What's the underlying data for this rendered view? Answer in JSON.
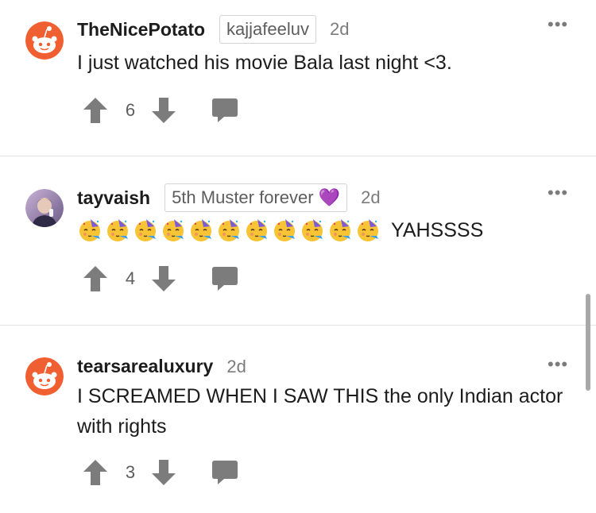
{
  "comments": [
    {
      "username": "TheNicePotato",
      "flair": "kajjafeeluv",
      "time": "2d",
      "body": "I just watched his movie Bala last night <3.",
      "votes": "6",
      "avatar": "snoo-avatar-icon"
    },
    {
      "username": "tayvaish",
      "flair": "5th Muster forever 💜",
      "time": "2d",
      "emoji": "partying-face",
      "emoji_count": 11,
      "body_text": "YAHSSSS",
      "votes": "4",
      "avatar": "user-photo-avatar"
    },
    {
      "username": "tearsarealuxury",
      "time": "2d",
      "body": "I SCREAMED WHEN I SAW THIS the only Indian actor with rights",
      "votes": "3",
      "avatar": "snoo-avatar-icon"
    }
  ],
  "icons": {
    "upvote": "upvote-arrow-icon",
    "downvote": "downvote-arrow-icon",
    "reply": "comment-bubble-icon",
    "more": "more-options-icon"
  },
  "colors": {
    "snoo_orange": "#f05f31",
    "icon_gray": "#7c7c7c",
    "text": "#1c1c1c",
    "divider": "#e2e2e2"
  }
}
